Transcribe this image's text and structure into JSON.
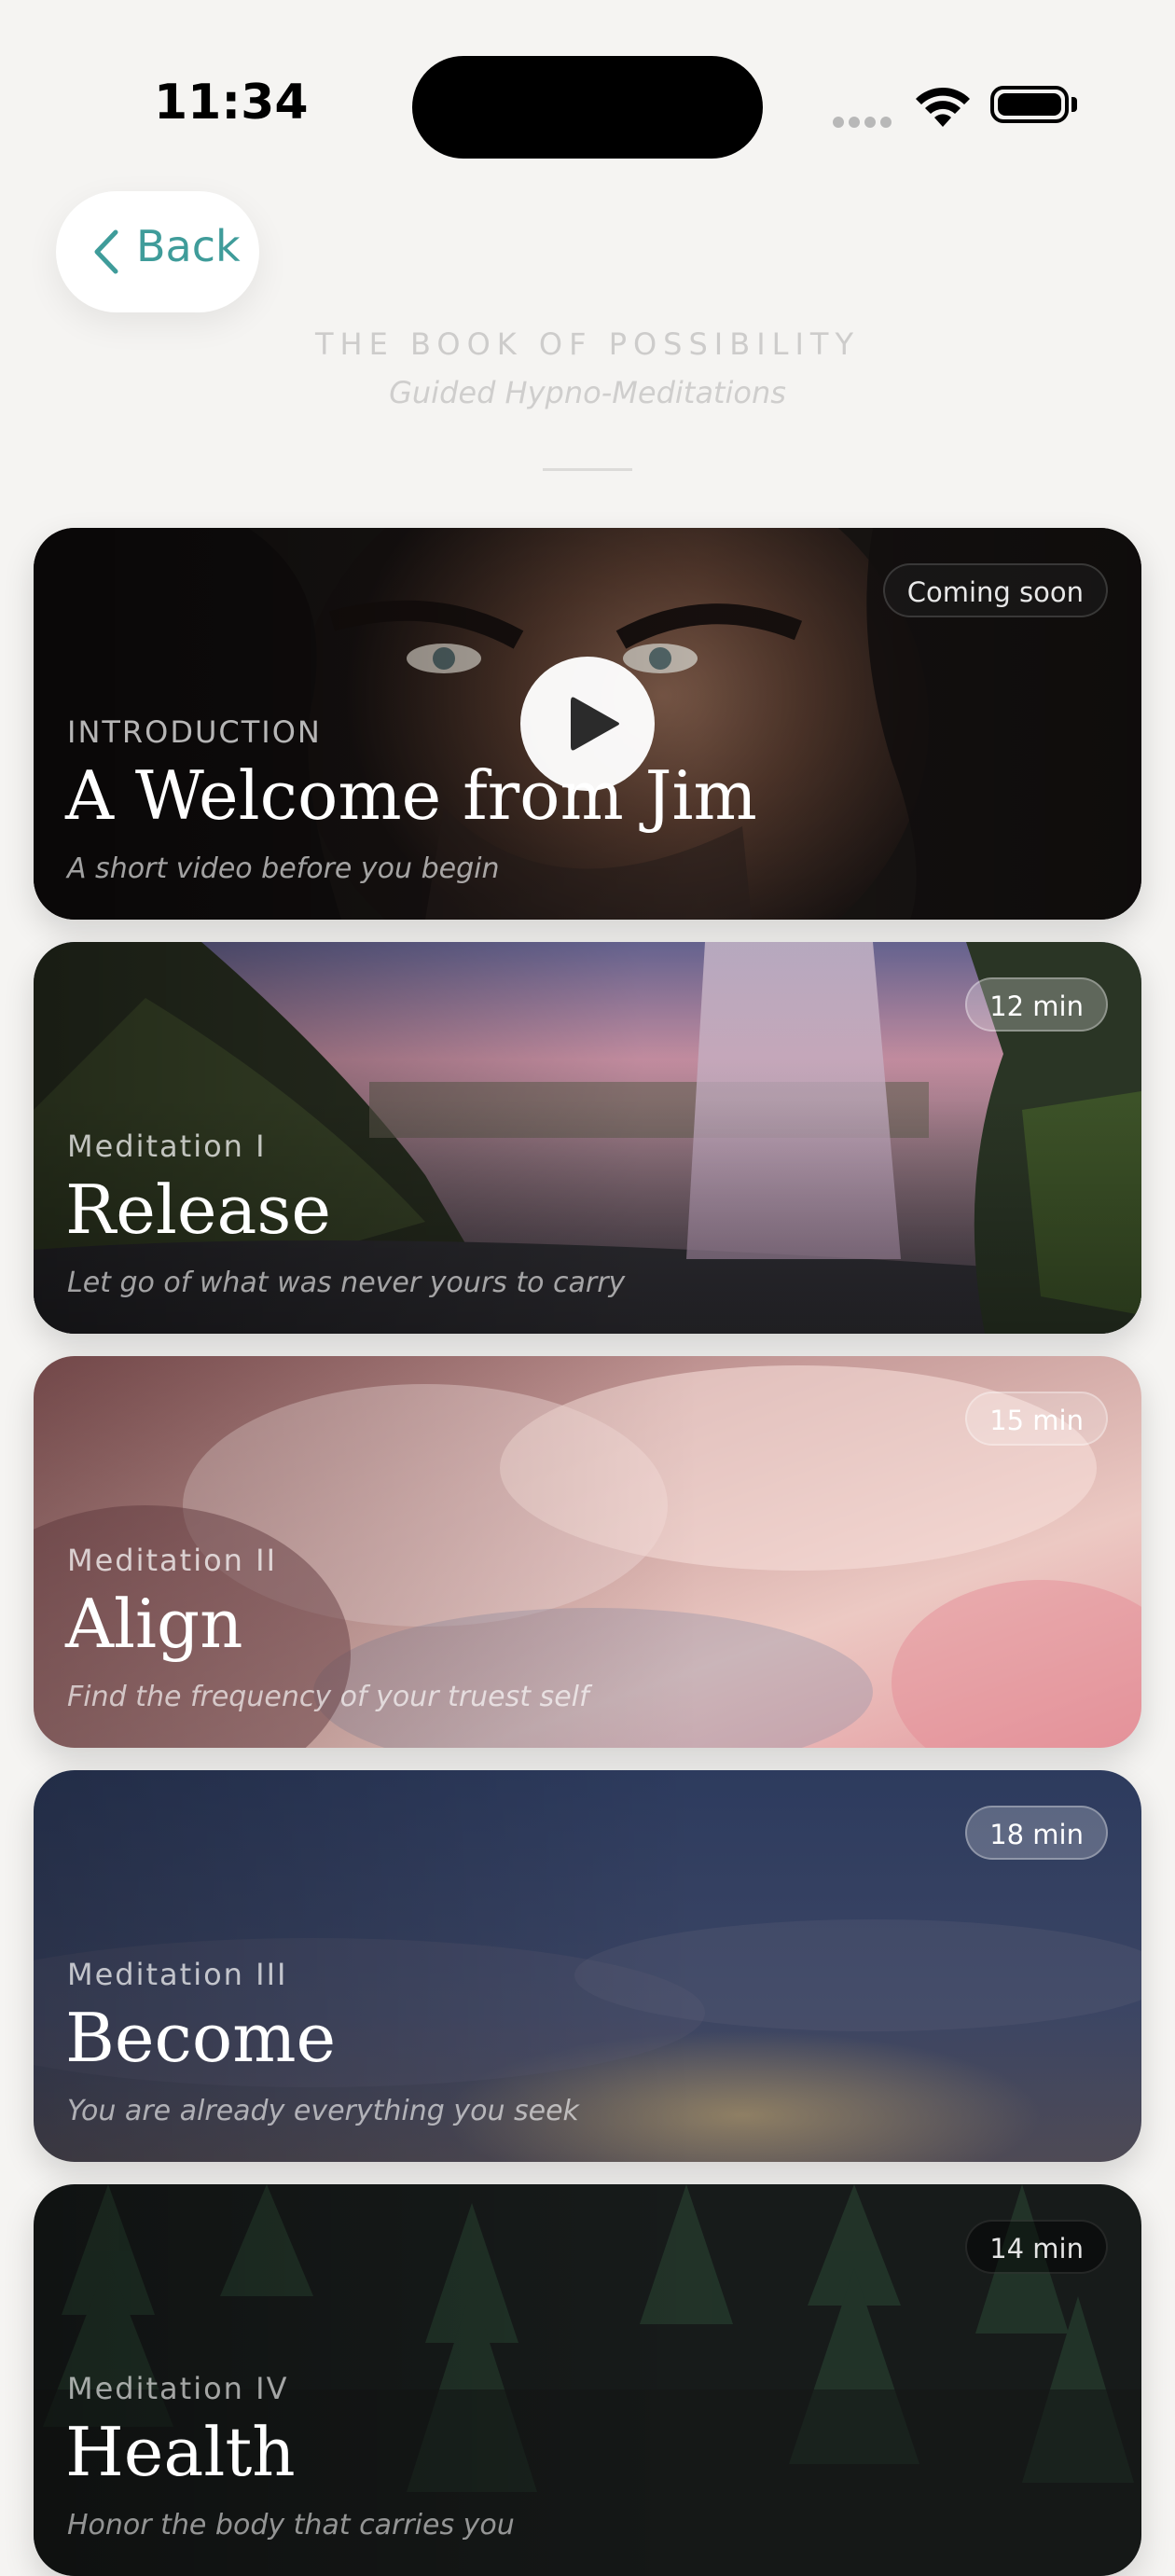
{
  "status_bar": {
    "time": "11:34"
  },
  "navigation": {
    "back_label": "Back"
  },
  "header": {
    "title": "THE BOOK OF POSSIBILITY",
    "subtitle": "Guided Hypno-Meditations"
  },
  "cards": [
    {
      "eyebrow": "INTRODUCTION",
      "title": "A Welcome from Jim",
      "subtitle": "A short video before you begin",
      "badge": "Coming soon",
      "has_play_button": true
    },
    {
      "eyebrow": "Meditation I",
      "title": "Release",
      "subtitle": "Let go of what was never yours to carry",
      "badge": "12 min"
    },
    {
      "eyebrow": "Meditation II",
      "title": "Align",
      "subtitle": "Find the frequency of your truest self",
      "badge": "15 min"
    },
    {
      "eyebrow": "Meditation III",
      "title": "Become",
      "subtitle": "You are already everything you seek",
      "badge": "18 min"
    },
    {
      "eyebrow": "Meditation IV",
      "title": "Health",
      "subtitle": "Honor the body that carries you",
      "badge": "14 min"
    }
  ],
  "colors": {
    "accent": "#3f9c9a",
    "background": "#f5f4f2"
  },
  "icons": {
    "back": "chevron-left-icon",
    "play": "play-icon"
  }
}
